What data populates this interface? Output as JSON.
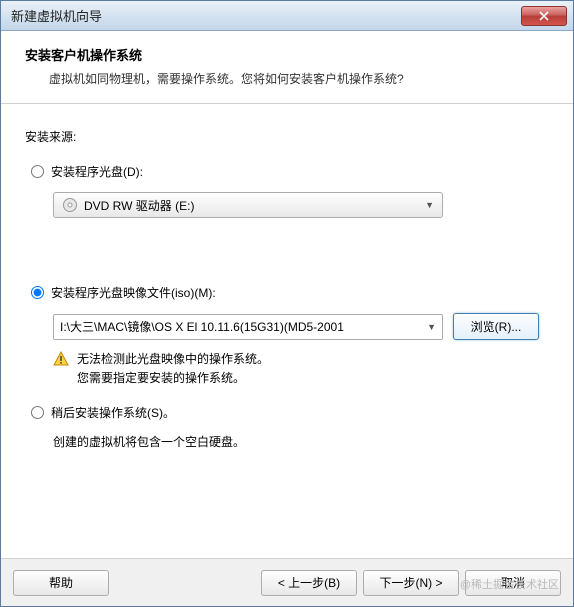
{
  "window": {
    "title": "新建虚拟机向导"
  },
  "header": {
    "title": "安装客户机操作系统",
    "subtitle": "虚拟机如同物理机，需要操作系统。您将如何安装客户机操作系统?"
  },
  "source": {
    "label": "安装来源:",
    "opt_disc": {
      "label": "安装程序光盘(D):",
      "drive": "DVD RW 驱动器 (E:)"
    },
    "opt_iso": {
      "label": "安装程序光盘映像文件(iso)(M):",
      "path": "I:\\大三\\MAC\\镜像\\OS X El 10.11.6(15G31)(MD5-2001",
      "browse": "浏览(R)...",
      "warning_line1": "无法检测此光盘映像中的操作系统。",
      "warning_line2": "您需要指定要安装的操作系统。"
    },
    "opt_later": {
      "label": "稍后安装操作系统(S)。",
      "info": "创建的虚拟机将包含一个空白硬盘。"
    }
  },
  "footer": {
    "help": "帮助",
    "back": "< 上一步(B)",
    "next": "下一步(N) >",
    "cancel": "取消"
  },
  "watermark": "@稀土掘金技术社区"
}
